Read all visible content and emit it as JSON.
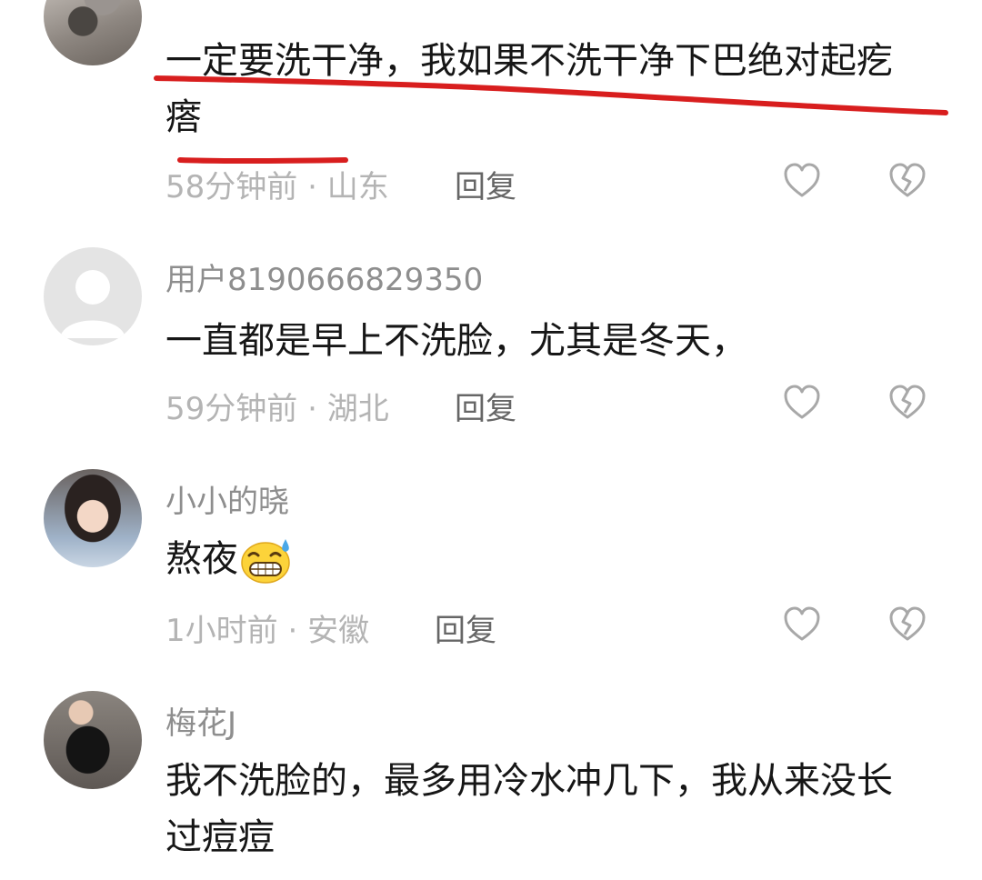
{
  "comments": [
    {
      "username": "",
      "text": "一定要洗干净，我如果不洗干净下巴绝对起疙瘩",
      "time": "58分钟前",
      "location": "山东",
      "reply_label": "回复",
      "highlighted": true
    },
    {
      "username": "用户8190666829350",
      "text": "一直都是早上不洗脸，尤其是冬天，",
      "time": "59分钟前",
      "location": "湖北",
      "reply_label": "回复"
    },
    {
      "username": "小小的晓",
      "text": "熬夜",
      "text_emoji": "grinning-sweat-emoji",
      "time": "1小时前",
      "location": "安徽",
      "reply_label": "回复"
    },
    {
      "username": "梅花J",
      "text": "我不洗脸的，最多用冷水冲几下，我从来没长过痘痘"
    }
  ],
  "meta_separator": "·",
  "icons": {
    "like": "heart-outline-icon",
    "dislike": "broken-heart-icon"
  },
  "colors": {
    "annotation_underline": "#d81e1e",
    "icon_gray": "#a8a8a8"
  }
}
